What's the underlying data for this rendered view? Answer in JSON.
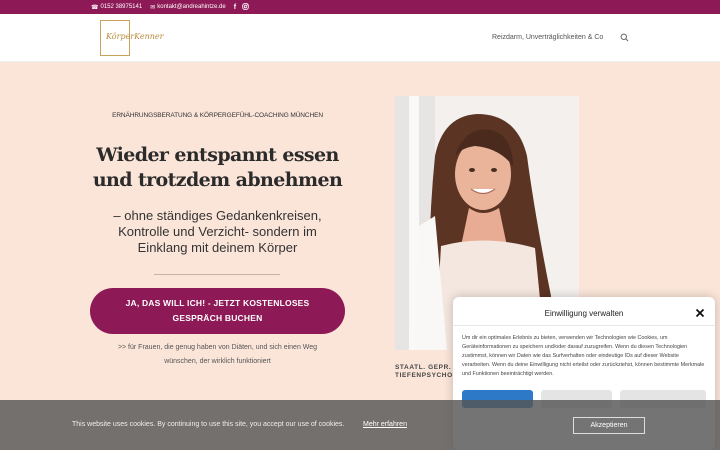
{
  "topbar": {
    "phone": "0152 38975141",
    "email": "kontakt@andreahintze.de",
    "phone_icon": "phone-icon",
    "email_icon": "envelope-icon",
    "social": [
      "facebook-icon",
      "instagram-icon"
    ]
  },
  "header": {
    "logo_text": "KörperKenner",
    "nav_item": "Reizdarm, Unverträglichkeiten & Co",
    "search_icon": "search-icon"
  },
  "hero": {
    "kicker": "ERNÄHRUNGSBERATUNG & KÖRPERGEFÜHL-COACHING MÜNCHEN",
    "headline_line1": "Wieder entspannt essen",
    "headline_line2": "und trotzdem abnehmen",
    "subline_1": "– ohne ständiges Gedankenkreisen,",
    "subline_2": "Kontrolle und Verzicht- sondern im",
    "subline_3": "Einklang mit deinem Körper",
    "cta": "JA, DAS WILL ICH! - JETZT KOSTENLOSES GESPRÄCH BUCHEN",
    "note_1": ">> für Frauen, die genug haben von Diäten, und sich einen Weg",
    "note_2": "wünschen, der wirklich funktioniert"
  },
  "profile": {
    "caption_1": "STAATL. GEPR.",
    "caption_2": "TIEFENPSYCHO"
  },
  "consent": {
    "title": "Einwilligung verwalten",
    "close_icon": "close-icon",
    "body": "Um dir ein optimales Erlebnis zu bieten, verwenden wir Technologien wie Cookies, um Geräteinformationen zu speichern und/oder darauf zuzugreifen. Wenn du diesen Technologien zustimmst, können wir Daten wie das Surfverhalten oder eindeutige IDs auf dieser Website verarbeiten. Wenn du deine Einwilligung nicht erteilst oder zurückziehst, können bestimmte Merkmale und Funktionen beeinträchtigt werden."
  },
  "cookiebar": {
    "message": "This website uses cookies. By continuing to use this site, you accept our use of cookies.",
    "more_link": "Mehr erfahren",
    "accept": "Akzeptieren"
  },
  "colors": {
    "brand": "#8d1957",
    "background": "#fbe5d9",
    "consent_accent": "#2d79c7"
  }
}
